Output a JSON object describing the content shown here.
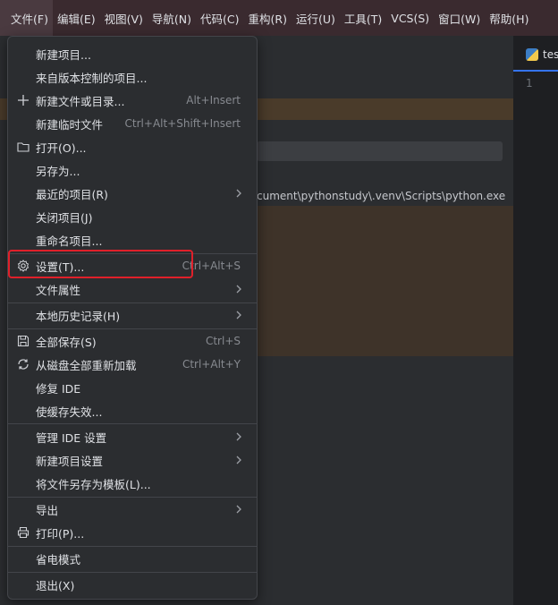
{
  "menubar": {
    "items": [
      "文件(F)",
      "编辑(E)",
      "视图(V)",
      "导航(N)",
      "代码(C)",
      "重构(R)",
      "运行(U)",
      "工具(T)",
      "VCS(S)",
      "窗口(W)",
      "帮助(H)"
    ]
  },
  "background": {
    "path_text": "cument\\pythonstudy\\.venv\\Scripts\\python.exe",
    "editor_tab": "tes",
    "line_number": "1"
  },
  "file_menu": {
    "new_project": "新建项目...",
    "from_vcs": "来自版本控制的项目...",
    "new_file": "新建文件或目录...",
    "new_file_shortcut": "Alt+Insert",
    "new_scratch": "新建临时文件",
    "new_scratch_shortcut": "Ctrl+Alt+Shift+Insert",
    "open": "打开(O)...",
    "save_as": "另存为...",
    "recent": "最近的项目(R)",
    "close_project": "关闭项目(J)",
    "rename_project": "重命名项目...",
    "settings": "设置(T)...",
    "settings_shortcut": "Ctrl+Alt+S",
    "file_properties": "文件属性",
    "local_history": "本地历史记录(H)",
    "save_all": "全部保存(S)",
    "save_all_shortcut": "Ctrl+S",
    "reload_all": "从磁盘全部重新加载",
    "reload_all_shortcut": "Ctrl+Alt+Y",
    "repair_ide": "修复 IDE",
    "invalidate_caches": "使缓存失效...",
    "manage_ide_settings": "管理 IDE 设置",
    "new_project_settings": "新建项目设置",
    "save_as_template": "将文件另存为模板(L)...",
    "export": "导出",
    "print": "打印(P)...",
    "power_save": "省电模式",
    "exit": "退出(X)"
  },
  "colors": {
    "menubar_bg": "#3a2a2f",
    "menu_bg": "#2b2d30",
    "highlight_border": "#e0202a"
  }
}
